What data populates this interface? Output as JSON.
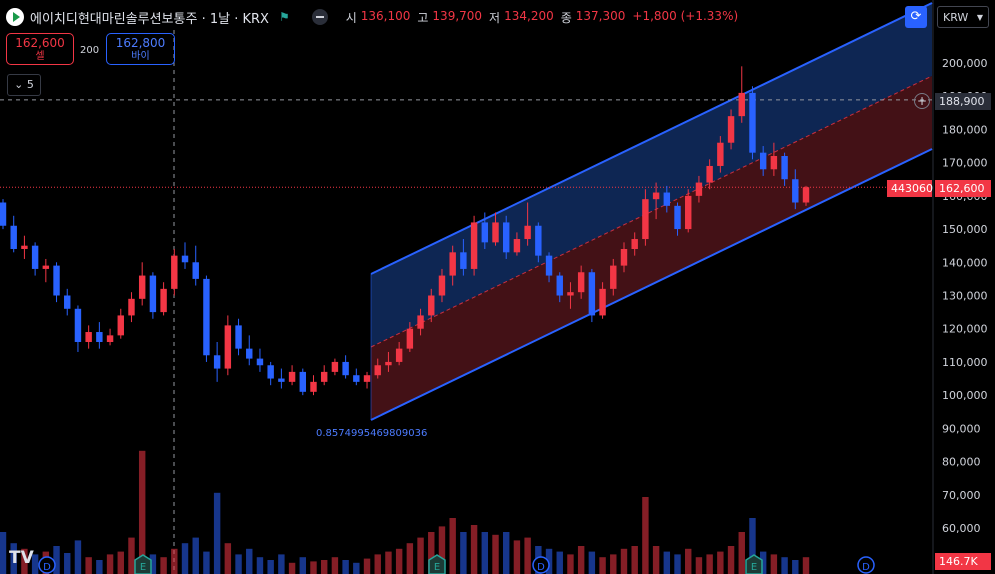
{
  "header": {
    "symbol_title": "에이치디현대마린솔루션보통주 · 1날 · KRX",
    "ohlc": [
      {
        "k": "시",
        "v": "136,100"
      },
      {
        "k": "고",
        "v": "139,700"
      },
      {
        "k": "저",
        "v": "134,200"
      },
      {
        "k": "종",
        "v": "137,300"
      },
      {
        "k": "",
        "v": "+1,800 (+1.33%)"
      }
    ]
  },
  "trade": {
    "sell_price": "162,600",
    "sell_label": "셀",
    "spread": "200",
    "buy_price": "162,800",
    "buy_label": "바이"
  },
  "layers_count": "5",
  "currency": "KRW",
  "tags": {
    "crosshair_price": "188,900",
    "last_price": "162,600",
    "code": "443060",
    "volume": "146.7K"
  },
  "fib_label": "0.8574995469809036",
  "tv_logo": "TV",
  "price_axis": [
    "200,000",
    "190,000",
    "180,000",
    "170,000",
    "160,000",
    "150,000",
    "140,000",
    "130,000",
    "120,000",
    "110,000",
    "100,000",
    "90,000",
    "80,000",
    "70,000",
    "60,000"
  ],
  "event_markers": [
    {
      "type": "D"
    },
    {
      "type": "E"
    },
    {
      "type": "E"
    },
    {
      "type": "D"
    },
    {
      "type": "E"
    },
    {
      "type": "D"
    }
  ],
  "colors": {
    "up": "#f23645",
    "down": "#2962ff",
    "channel_upper_fill": "#0f2a5c",
    "channel_lower_fill": "#4a1318",
    "channel_line": "#2962ff",
    "mid_line": "#f23645"
  },
  "chart_data": {
    "type": "candlestick",
    "ylim": [
      55000,
      205000
    ],
    "last_price": 162600,
    "crosshair_price": 188900,
    "candles": [
      {
        "o": 158000,
        "h": 159000,
        "l": 150000,
        "c": 151000
      },
      {
        "o": 151000,
        "h": 154000,
        "l": 143000,
        "c": 144000
      },
      {
        "o": 144000,
        "h": 148000,
        "l": 141000,
        "c": 145000
      },
      {
        "o": 145000,
        "h": 146000,
        "l": 136000,
        "c": 138000
      },
      {
        "o": 138000,
        "h": 141000,
        "l": 134000,
        "c": 139000
      },
      {
        "o": 139000,
        "h": 140000,
        "l": 128000,
        "c": 130000
      },
      {
        "o": 130000,
        "h": 132000,
        "l": 124000,
        "c": 126000
      },
      {
        "o": 126000,
        "h": 127000,
        "l": 113000,
        "c": 116000
      },
      {
        "o": 116000,
        "h": 121000,
        "l": 114000,
        "c": 119000
      },
      {
        "o": 119000,
        "h": 122000,
        "l": 114000,
        "c": 116000
      },
      {
        "o": 116000,
        "h": 120000,
        "l": 115000,
        "c": 118000
      },
      {
        "o": 118000,
        "h": 126000,
        "l": 117000,
        "c": 124000
      },
      {
        "o": 124000,
        "h": 131000,
        "l": 122000,
        "c": 129000
      },
      {
        "o": 129000,
        "h": 140000,
        "l": 127000,
        "c": 136000
      },
      {
        "o": 136000,
        "h": 137000,
        "l": 123000,
        "c": 125000
      },
      {
        "o": 125000,
        "h": 134000,
        "l": 124000,
        "c": 132000
      },
      {
        "o": 132000,
        "h": 144000,
        "l": 130000,
        "c": 142000
      },
      {
        "o": 142000,
        "h": 146000,
        "l": 138000,
        "c": 140000
      },
      {
        "o": 140000,
        "h": 145000,
        "l": 133000,
        "c": 135000
      },
      {
        "o": 135000,
        "h": 136000,
        "l": 110000,
        "c": 112000
      },
      {
        "o": 112000,
        "h": 116000,
        "l": 104000,
        "c": 108000
      },
      {
        "o": 108000,
        "h": 124000,
        "l": 106000,
        "c": 121000
      },
      {
        "o": 121000,
        "h": 123000,
        "l": 112000,
        "c": 114000
      },
      {
        "o": 114000,
        "h": 118000,
        "l": 109000,
        "c": 111000
      },
      {
        "o": 111000,
        "h": 114000,
        "l": 107000,
        "c": 109000
      },
      {
        "o": 109000,
        "h": 110000,
        "l": 103000,
        "c": 105000
      },
      {
        "o": 105000,
        "h": 108000,
        "l": 102000,
        "c": 104000
      },
      {
        "o": 104000,
        "h": 109000,
        "l": 103000,
        "c": 107000
      },
      {
        "o": 107000,
        "h": 108000,
        "l": 100000,
        "c": 101000
      },
      {
        "o": 101000,
        "h": 106000,
        "l": 100000,
        "c": 104000
      },
      {
        "o": 104000,
        "h": 109000,
        "l": 103000,
        "c": 107000
      },
      {
        "o": 107000,
        "h": 111000,
        "l": 106000,
        "c": 110000
      },
      {
        "o": 110000,
        "h": 112000,
        "l": 105000,
        "c": 106000
      },
      {
        "o": 106000,
        "h": 108000,
        "l": 103000,
        "c": 104000
      },
      {
        "o": 104000,
        "h": 107000,
        "l": 102000,
        "c": 106000
      },
      {
        "o": 106000,
        "h": 111000,
        "l": 105000,
        "c": 109000
      },
      {
        "o": 109000,
        "h": 113000,
        "l": 107000,
        "c": 110000
      },
      {
        "o": 110000,
        "h": 116000,
        "l": 109000,
        "c": 114000
      },
      {
        "o": 114000,
        "h": 122000,
        "l": 113000,
        "c": 120000
      },
      {
        "o": 120000,
        "h": 126000,
        "l": 118000,
        "c": 124000
      },
      {
        "o": 124000,
        "h": 132000,
        "l": 122000,
        "c": 130000
      },
      {
        "o": 130000,
        "h": 138000,
        "l": 128000,
        "c": 136000
      },
      {
        "o": 136000,
        "h": 145000,
        "l": 133000,
        "c": 143000
      },
      {
        "o": 143000,
        "h": 147000,
        "l": 136000,
        "c": 138000
      },
      {
        "o": 138000,
        "h": 154000,
        "l": 136000,
        "c": 152000
      },
      {
        "o": 152000,
        "h": 155000,
        "l": 144000,
        "c": 146000
      },
      {
        "o": 146000,
        "h": 155000,
        "l": 145000,
        "c": 152000
      },
      {
        "o": 152000,
        "h": 154000,
        "l": 141000,
        "c": 143000
      },
      {
        "o": 143000,
        "h": 149000,
        "l": 142000,
        "c": 147000
      },
      {
        "o": 147000,
        "h": 158000,
        "l": 145000,
        "c": 151000
      },
      {
        "o": 151000,
        "h": 152000,
        "l": 140000,
        "c": 142000
      },
      {
        "o": 142000,
        "h": 143000,
        "l": 134000,
        "c": 136000
      },
      {
        "o": 136000,
        "h": 137000,
        "l": 128000,
        "c": 130000
      },
      {
        "o": 130000,
        "h": 134000,
        "l": 126000,
        "c": 131000
      },
      {
        "o": 131000,
        "h": 139000,
        "l": 129000,
        "c": 137000
      },
      {
        "o": 137000,
        "h": 138000,
        "l": 122000,
        "c": 124000
      },
      {
        "o": 124000,
        "h": 134000,
        "l": 123000,
        "c": 132000
      },
      {
        "o": 132000,
        "h": 141000,
        "l": 130000,
        "c": 139000
      },
      {
        "o": 139000,
        "h": 146000,
        "l": 137000,
        "c": 144000
      },
      {
        "o": 144000,
        "h": 149000,
        "l": 142000,
        "c": 147000
      },
      {
        "o": 147000,
        "h": 162000,
        "l": 145000,
        "c": 159000
      },
      {
        "o": 159000,
        "h": 164000,
        "l": 153000,
        "c": 161000
      },
      {
        "o": 161000,
        "h": 163000,
        "l": 155000,
        "c": 157000
      },
      {
        "o": 157000,
        "h": 158000,
        "l": 148000,
        "c": 150000
      },
      {
        "o": 150000,
        "h": 162000,
        "l": 149000,
        "c": 160000
      },
      {
        "o": 160000,
        "h": 166000,
        "l": 158000,
        "c": 164000
      },
      {
        "o": 164000,
        "h": 171000,
        "l": 162000,
        "c": 169000
      },
      {
        "o": 169000,
        "h": 178000,
        "l": 167000,
        "c": 176000
      },
      {
        "o": 176000,
        "h": 186000,
        "l": 174000,
        "c": 184000
      },
      {
        "o": 184000,
        "h": 199000,
        "l": 182000,
        "c": 191000
      },
      {
        "o": 191000,
        "h": 193000,
        "l": 171000,
        "c": 173000
      },
      {
        "o": 173000,
        "h": 175000,
        "l": 166000,
        "c": 168000
      },
      {
        "o": 168000,
        "h": 176000,
        "l": 166000,
        "c": 172000
      },
      {
        "o": 172000,
        "h": 173000,
        "l": 163000,
        "c": 165000
      },
      {
        "o": 165000,
        "h": 168000,
        "l": 156000,
        "c": 158000
      },
      {
        "o": 158000,
        "h": 163000,
        "l": 157000,
        "c": 162600
      }
    ],
    "volume_max": 88000,
    "volumes": [
      30,
      22,
      18,
      14,
      16,
      20,
      15,
      24,
      12,
      10,
      14,
      16,
      26,
      88,
      14,
      12,
      18,
      22,
      26,
      16,
      58,
      22,
      14,
      18,
      12,
      10,
      14,
      8,
      12,
      9,
      10,
      12,
      10,
      8,
      11,
      14,
      16,
      18,
      22,
      26,
      30,
      34,
      40,
      30,
      35,
      30,
      28,
      30,
      24,
      26,
      20,
      18,
      16,
      14,
      20,
      16,
      12,
      14,
      18,
      20,
      55,
      20,
      16,
      14,
      18,
      12,
      14,
      16,
      20,
      30,
      40,
      16,
      14,
      12,
      10,
      12
    ]
  }
}
